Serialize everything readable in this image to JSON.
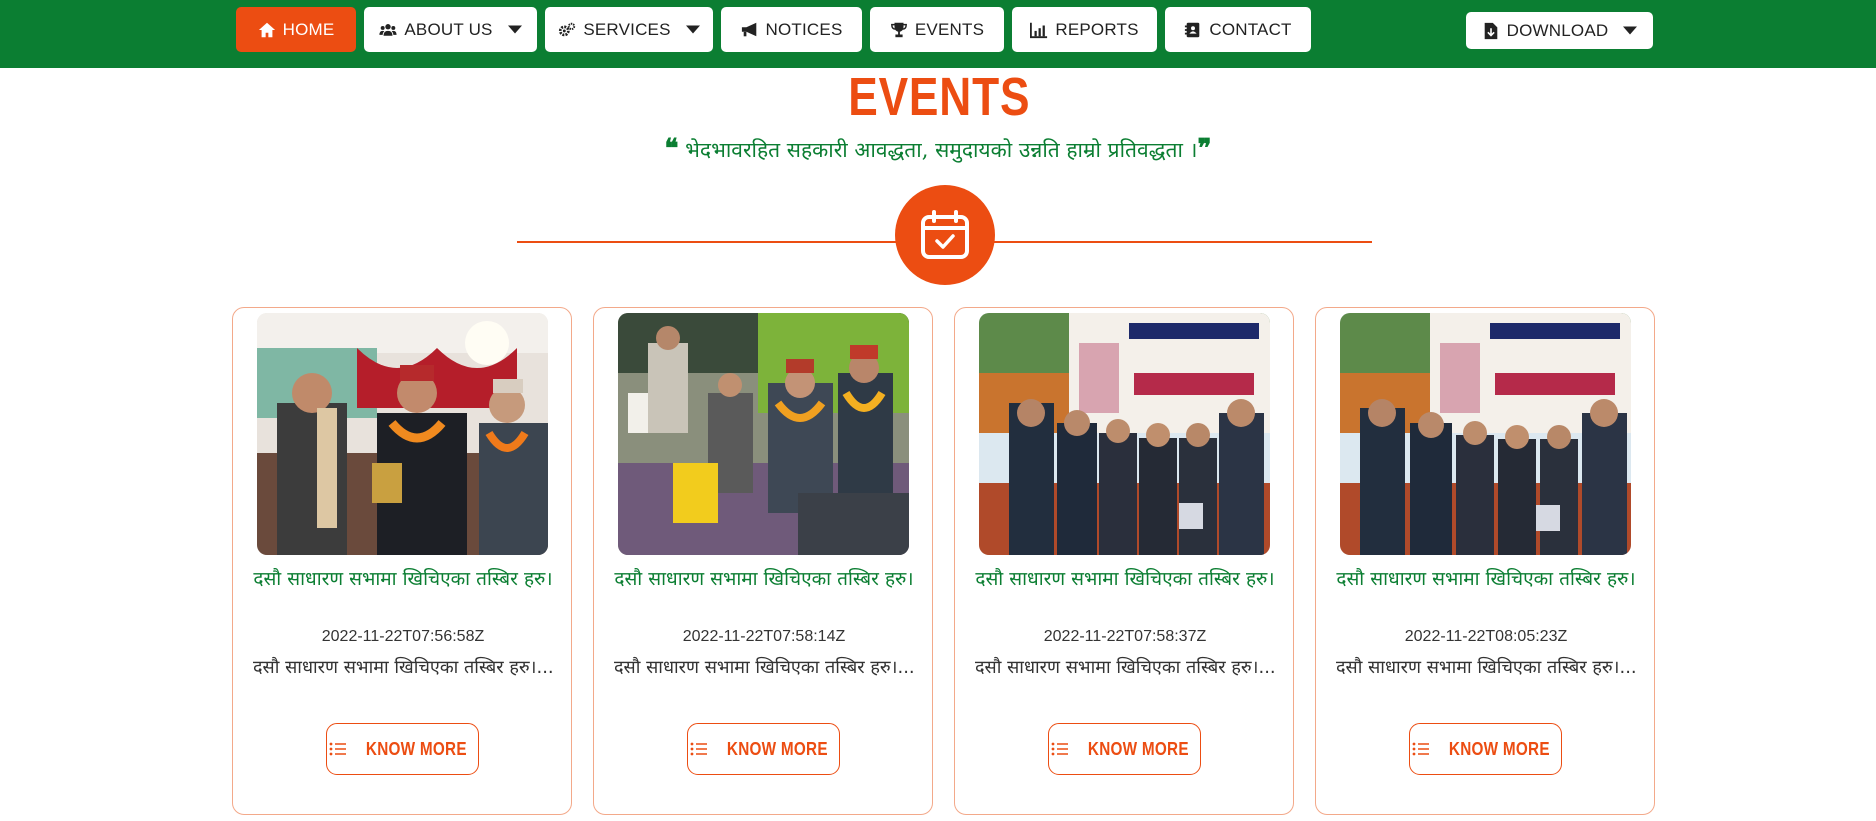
{
  "nav": {
    "items": [
      {
        "label": "HOME",
        "icon": "home-icon",
        "active": true
      },
      {
        "label": "ABOUT US",
        "icon": "users-icon",
        "dropdown": true
      },
      {
        "label": "SERVICES",
        "icon": "gears-icon",
        "dropdown": true
      },
      {
        "label": "NOTICES",
        "icon": "bullhorn-icon"
      },
      {
        "label": "EVENTS",
        "icon": "trophy-icon"
      },
      {
        "label": "REPORTS",
        "icon": "chart-icon"
      },
      {
        "label": "CONTACT",
        "icon": "address-book-icon"
      }
    ],
    "download": {
      "label": "DOWNLOAD",
      "icon": "file-download-icon",
      "dropdown": true
    }
  },
  "section": {
    "title": "EVENTS",
    "tagline_open": "❝",
    "tagline": " भेदभावरहित सहकारी आवद्धता, समुदायको उन्नति हाम्रो प्रतिवद्धता ।",
    "tagline_close": "❞",
    "icon": "calendar-check-icon"
  },
  "events": [
    {
      "title": "दसौ साधारण सभामा खिचिएका तस्बिर हरु।",
      "date": "2022-11-22T07:56:58Z",
      "description": "दसौ साधारण सभामा खिचिएका तस्बिर हरु।...",
      "button": "KNOW MORE"
    },
    {
      "title": "दसौ साधारण सभामा खिचिएका तस्बिर हरु।",
      "date": "2022-11-22T07:58:14Z",
      "description": "दसौ साधारण सभामा खिचिएका तस्बिर हरु।...",
      "button": "KNOW MORE"
    },
    {
      "title": "दसौ साधारण सभामा खिचिएका तस्बिर हरु।",
      "date": "2022-11-22T07:58:37Z",
      "description": "दसौ साधारण सभामा खिचिएका तस्बिर हरु।...",
      "button": "KNOW MORE"
    },
    {
      "title": "दसौ साधारण सभामा खिचिएका तस्बिर हरु।",
      "date": "2022-11-22T08:05:23Z",
      "description": "दसौ साधारण सभामा खिचिएका तस्बिर हरु।...",
      "button": "KNOW MORE"
    }
  ],
  "colors": {
    "brand_green": "#0b7e32",
    "accent_orange": "#ec4d12",
    "card_border": "#f3a98a"
  }
}
